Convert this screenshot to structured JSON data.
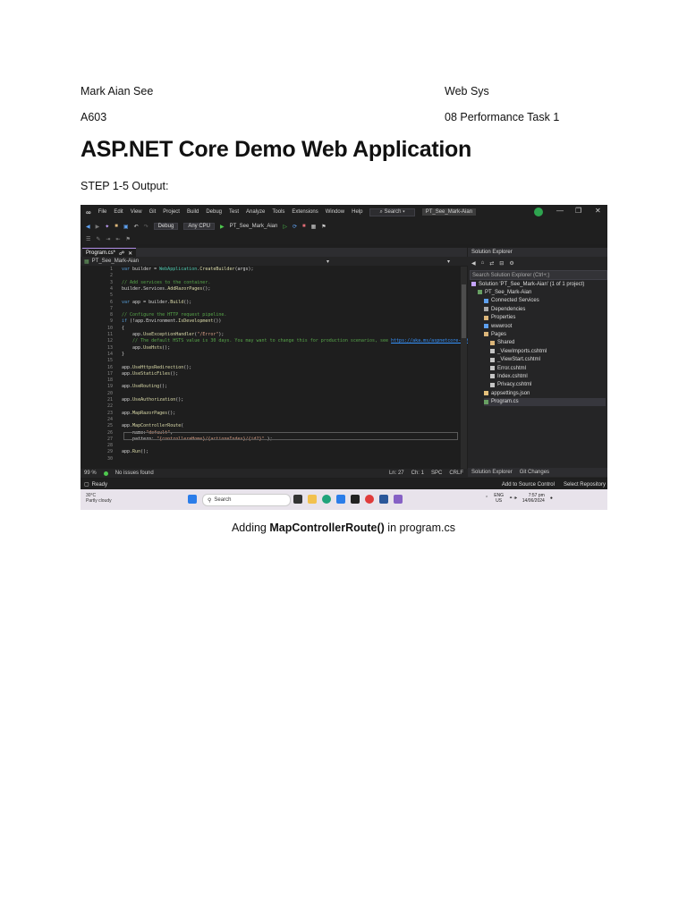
{
  "header": {
    "author": "Mark Aian See",
    "course": "Web Sys",
    "section": "A603",
    "task": "08 Performance Task 1"
  },
  "title": "ASP.NET Core Demo Web Application",
  "step_label": "STEP 1-5 Output:",
  "screenshot": {
    "menu": [
      "File",
      "Edit",
      "View",
      "Git",
      "Project",
      "Build",
      "Debug",
      "Test",
      "Analyze",
      "Tools",
      "Extensions",
      "Window",
      "Help"
    ],
    "search_label": "Search",
    "project_chip": "PT_See_Mark-Aian",
    "avatar_initials": "AS",
    "toolbar": {
      "config": "Debug",
      "platform": "Any CPU",
      "run_target": "PT_See_Mark_Aian"
    },
    "editor": {
      "tab_label": "Program.cs*",
      "nav_project": "PT_See_Mark-Aian",
      "lines": [
        {
          "n": "1",
          "code": "var builder = WebApplication.CreateBuilder(args);"
        },
        {
          "n": "2",
          "code": ""
        },
        {
          "n": "3",
          "code": "// Add services to the container."
        },
        {
          "n": "4",
          "code": "builder.Services.AddRazorPages();"
        },
        {
          "n": "5",
          "code": ""
        },
        {
          "n": "6",
          "code": "var app = builder.Build();"
        },
        {
          "n": "7",
          "code": ""
        },
        {
          "n": "8",
          "code": "// Configure the HTTP request pipeline."
        },
        {
          "n": "9",
          "code": "if (!app.Environment.IsDevelopment())"
        },
        {
          "n": "10",
          "code": "{"
        },
        {
          "n": "11",
          "code": "    app.UseExceptionHandler(\"/Error\");"
        },
        {
          "n": "12",
          "code": "    // The default HSTS value is 30 days. You may want to change this for production scenarios, see https://aka.ms/aspnetcore-hsts."
        },
        {
          "n": "13",
          "code": "    app.UseHsts();"
        },
        {
          "n": "14",
          "code": "}"
        },
        {
          "n": "15",
          "code": ""
        },
        {
          "n": "16",
          "code": "app.UseHttpsRedirection();"
        },
        {
          "n": "17",
          "code": "app.UseStaticFiles();"
        },
        {
          "n": "18",
          "code": ""
        },
        {
          "n": "19",
          "code": "app.UseRouting();"
        },
        {
          "n": "20",
          "code": ""
        },
        {
          "n": "21",
          "code": "app.UseAuthorization();"
        },
        {
          "n": "22",
          "code": ""
        },
        {
          "n": "23",
          "code": "app.MapRazorPages();"
        },
        {
          "n": "24",
          "code": ""
        },
        {
          "n": "25",
          "code": "app.MapControllerRoute("
        },
        {
          "n": "26",
          "code": "    name:\"default\","
        },
        {
          "n": "27",
          "code": "    pattern: \"{controller=Home}/{action=Index}/{id?}\" );"
        },
        {
          "n": "28",
          "code": ""
        },
        {
          "n": "29",
          "code": "app.Run();"
        },
        {
          "n": "30",
          "code": ""
        }
      ],
      "zoom": "99 %",
      "issues": "No issues found",
      "position": "Ln: 27",
      "column": "Ch: 1",
      "spacing": "SPC",
      "line_ending": "CRLF"
    },
    "solution_explorer": {
      "title": "Solution Explorer",
      "search_placeholder": "Search Solution Explorer (Ctrl+;)",
      "items": [
        {
          "label": "Solution 'PT_See_Mark-Aian' (1 of 1 project)",
          "depth": 0,
          "icon": "solution-icon"
        },
        {
          "label": "PT_See_Mark-Aian",
          "depth": 1,
          "icon": "project-icon"
        },
        {
          "label": "Connected Services",
          "depth": 2,
          "icon": "connected-services-icon"
        },
        {
          "label": "Dependencies",
          "depth": 2,
          "icon": "dependencies-icon"
        },
        {
          "label": "Properties",
          "depth": 2,
          "icon": "properties-icon"
        },
        {
          "label": "wwwroot",
          "depth": 2,
          "icon": "globe-icon"
        },
        {
          "label": "Pages",
          "depth": 2,
          "icon": "folder-icon"
        },
        {
          "label": "Shared",
          "depth": 3,
          "icon": "folder-icon"
        },
        {
          "label": "_ViewImports.cshtml",
          "depth": 3,
          "icon": "file-icon"
        },
        {
          "label": "_ViewStart.cshtml",
          "depth": 3,
          "icon": "file-icon"
        },
        {
          "label": "Error.cshtml",
          "depth": 3,
          "icon": "file-icon"
        },
        {
          "label": "Index.cshtml",
          "depth": 3,
          "icon": "file-icon"
        },
        {
          "label": "Privacy.cshtml",
          "depth": 3,
          "icon": "file-icon"
        },
        {
          "label": "appsettings.json",
          "depth": 2,
          "icon": "json-icon"
        },
        {
          "label": "Program.cs",
          "depth": 2,
          "icon": "csharp-icon"
        }
      ],
      "tabs": [
        "Solution Explorer",
        "Git Changes"
      ]
    },
    "status": {
      "ready": "Ready",
      "source_control": "Add to Source Control",
      "repository": "Select Repository"
    },
    "taskbar": {
      "temperature": "30°C",
      "weather": "Partly cloudy",
      "search": "Search",
      "lang": "ENG",
      "region": "US",
      "time": "7:57 pm",
      "date": "14/06/2024"
    }
  },
  "caption": {
    "prefix": "Adding ",
    "bold": "MapControllerRoute()",
    "suffix": " in program.cs"
  }
}
